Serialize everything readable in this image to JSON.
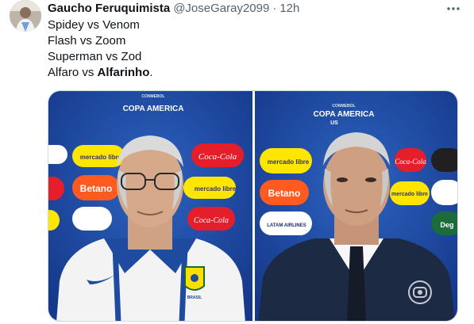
{
  "tweet": {
    "author_name": "Gaucho Feruquimista",
    "handle": "@JoseGaray2099",
    "separator": "·",
    "time": "12h",
    "lines": [
      "Spidey vs Venom",
      "Flash vs Zoom",
      "Superman vs Zod"
    ],
    "last_line_prefix": "Alfaro vs ",
    "last_line_bold": "Alfarinho",
    "last_line_suffix": "."
  },
  "media": {
    "left": {
      "banner": "COPA AMERICA",
      "banner_small": "CONMEBOL",
      "sponsors": [
        "mercado libre",
        "Coca-Cola",
        "Betano",
        "mercado libre",
        "Coca-Cola"
      ],
      "badge_text": "BRASIL"
    },
    "right": {
      "banner": "COPA AMERICA",
      "banner_small": "CONMEBOL",
      "banner_suffix": "US",
      "sponsors": [
        "mercado libre",
        "Coca-Cola",
        "Betano",
        "mercado libre",
        "LATAM AIRLINES",
        "Deg"
      ]
    }
  },
  "colors": {
    "backdrop_blue": "#1f4ea6",
    "mercado_yellow": "#ffe600",
    "coca_red": "#e41e2b",
    "betano_orange": "#ff5a1f",
    "text_muted": "#536471"
  }
}
